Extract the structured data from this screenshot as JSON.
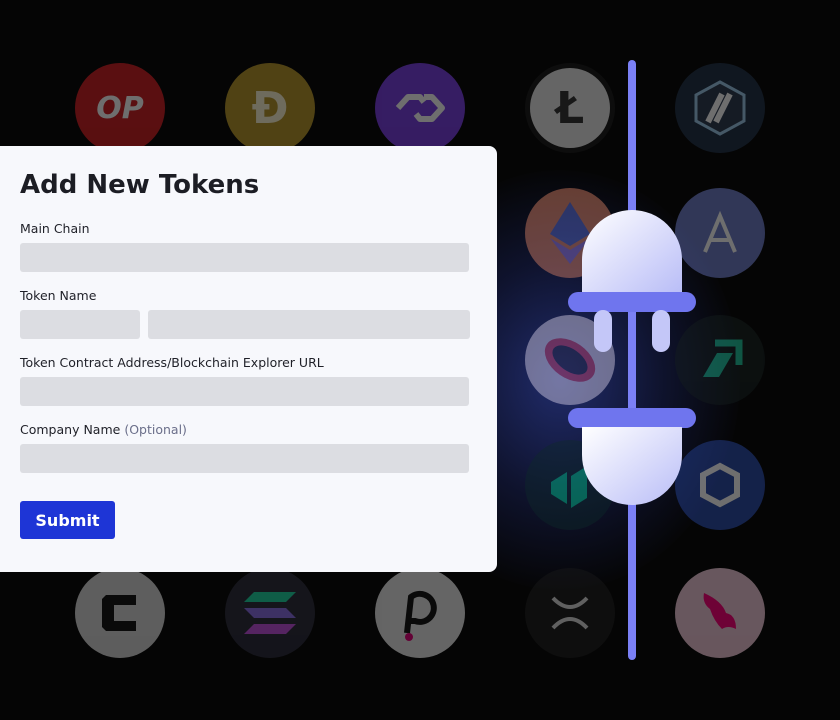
{
  "form": {
    "title": "Add New Tokens",
    "main_chain_label": "Main Chain",
    "main_chain_value": "",
    "token_name_label": "Token Name",
    "token_symbol_value": "",
    "token_name_value": "",
    "contract_label": "Token Contract Address/Blockchain Explorer URL",
    "contract_value": "",
    "company_label": "Company Name",
    "company_optional": "(Optional)",
    "company_value": "",
    "submit_label": "Submit"
  },
  "background": {
    "coins": [
      {
        "name": "optimism-coin",
        "glyph": "OP",
        "color": "#d01e22"
      },
      {
        "name": "dogecoin-coin",
        "glyph": "Ð",
        "color": "#b8962a"
      },
      {
        "name": "polygon-coin",
        "glyph": "",
        "color": "#7b3fe4"
      },
      {
        "name": "litecoin-coin",
        "glyph": "Ł",
        "color": "#e8e8e8"
      },
      {
        "name": "arbitrum-coin",
        "glyph": "",
        "color": "#2d3a4f"
      },
      {
        "name": "ethereum-coin",
        "glyph": "",
        "color": "#e88a6a"
      },
      {
        "name": "aave-coin",
        "glyph": "",
        "color": "#6e7cc8"
      },
      {
        "name": "sushi-coin",
        "glyph": "",
        "color": "#c9b7e6"
      },
      {
        "name": "arrow-coin",
        "glyph": "",
        "color": "#1b2b2a"
      },
      {
        "name": "compound-coin",
        "glyph": "",
        "color": "#0e2a2a"
      },
      {
        "name": "chainlink-coin",
        "glyph": "",
        "color": "#2a4aa8"
      },
      {
        "name": "celo-coin",
        "glyph": "",
        "color": "#d8d8d8"
      },
      {
        "name": "solana-coin",
        "glyph": "",
        "color": "#2b2b3b"
      },
      {
        "name": "polkadot-coin",
        "glyph": "",
        "color": "#eaeaea"
      },
      {
        "name": "xrp-coin",
        "glyph": "",
        "color": "#1c1c1c"
      },
      {
        "name": "uniswap-coin",
        "glyph": "",
        "color": "#f2c9d9"
      }
    ]
  }
}
